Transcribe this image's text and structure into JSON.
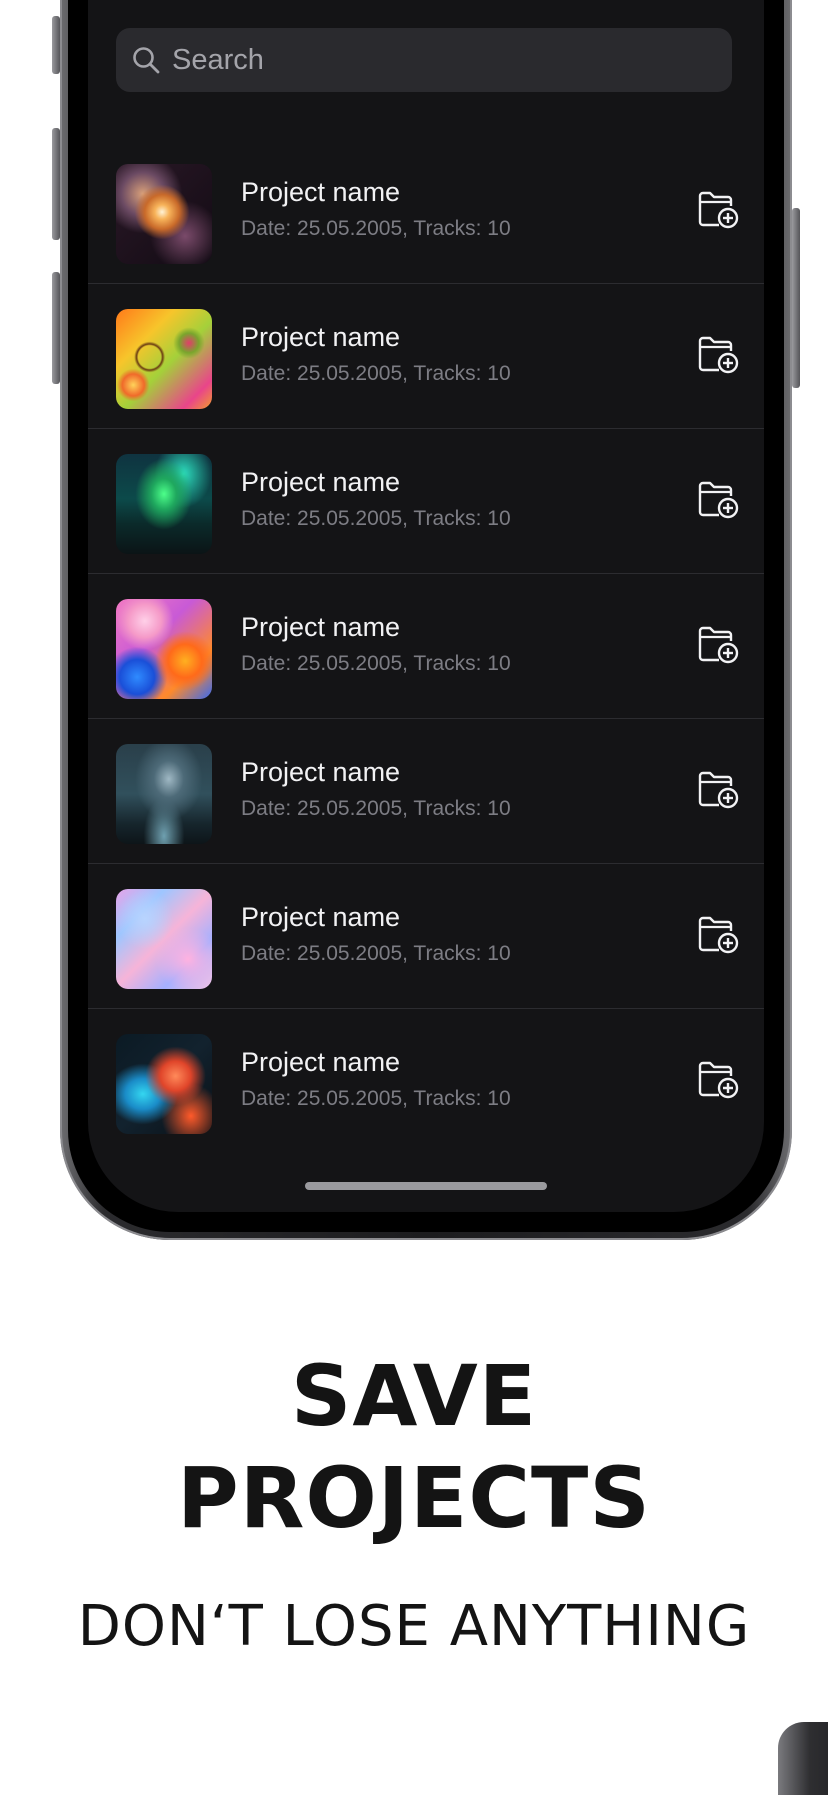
{
  "search": {
    "placeholder": "Search"
  },
  "projects": [
    {
      "title": "Project name",
      "meta": "Date: 25.05.2005, Tracks: 10",
      "thumb": "orange-smoke"
    },
    {
      "title": "Project name",
      "meta": "Date: 25.05.2005, Tracks: 10",
      "thumb": "oil-bubbles"
    },
    {
      "title": "Project name",
      "meta": "Date: 25.05.2005, Tracks: 10",
      "thumb": "aurora"
    },
    {
      "title": "Project name",
      "meta": "Date: 25.05.2005, Tracks: 10",
      "thumb": "pink-bubbles"
    },
    {
      "title": "Project name",
      "meta": "Date: 25.05.2005, Tracks: 10",
      "thumb": "milky-way"
    },
    {
      "title": "Project name",
      "meta": "Date: 25.05.2005, Tracks: 10",
      "thumb": "pastel-marble"
    },
    {
      "title": "Project name",
      "meta": "Date: 25.05.2005, Tracks: 10",
      "thumb": "blue-orange-smoke"
    }
  ],
  "row_action_icon": "folder-add-icon",
  "marketing": {
    "headline_line1": "SAVE",
    "headline_line2": "PROJECTS",
    "subheadline": "DON‘T LOSE ANYTHING"
  },
  "colors": {
    "screen_bg": "#141416",
    "search_bg": "#2a2a2e",
    "title_text": "#f2f2f4",
    "meta_text": "#7d7d84",
    "page_bg": "#ffffff",
    "headline_text": "#141414"
  }
}
